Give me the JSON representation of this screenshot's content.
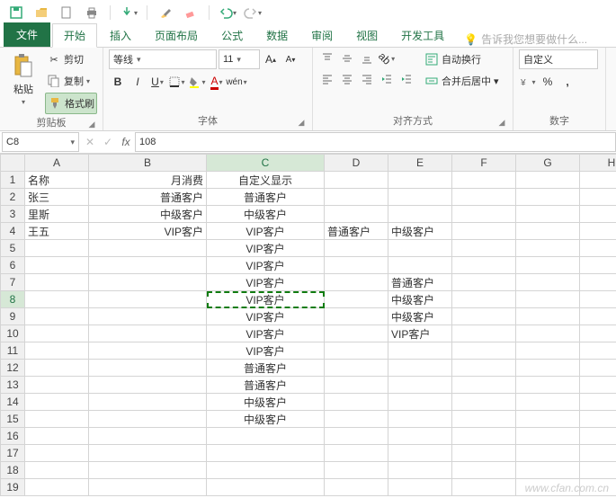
{
  "tabs": {
    "file": "文件",
    "items": [
      "开始",
      "插入",
      "页面布局",
      "公式",
      "数据",
      "审阅",
      "视图",
      "开发工具"
    ],
    "active_index": 0,
    "tell_me": "告诉我您想要做什么..."
  },
  "clipboard": {
    "paste": "粘贴",
    "cut": "剪切",
    "copy": "复制",
    "format_painter": "格式刷",
    "group_label": "剪贴板"
  },
  "font": {
    "name": "等线",
    "size": "11",
    "group_label": "字体"
  },
  "alignment": {
    "wrap": "自动换行",
    "merge": "合并后居中",
    "group_label": "对齐方式"
  },
  "number": {
    "format": "自定义",
    "group_label": "数字"
  },
  "formula_bar": {
    "cell_ref": "C8",
    "value": "108"
  },
  "columns": [
    "A",
    "B",
    "C",
    "D",
    "E",
    "F",
    "G",
    "H"
  ],
  "selected_col": "C",
  "selected_row": 8,
  "grid": [
    {
      "A": "名称",
      "B": "月消费",
      "C": "自定义显示",
      "D": "",
      "E": "",
      "F": ""
    },
    {
      "A": "张三",
      "B": "普通客户",
      "C": "普通客户",
      "D": "",
      "E": "",
      "F": ""
    },
    {
      "A": "里斯",
      "B": "中级客户",
      "C": "中级客户",
      "D": "",
      "E": "",
      "F": ""
    },
    {
      "A": "王五",
      "B": "VIP客户",
      "C": "VIP客户",
      "D": "普通客户",
      "E": "中级客户",
      "F": ""
    },
    {
      "A": "",
      "B": "",
      "C": "VIP客户",
      "D": "",
      "E": "",
      "F": ""
    },
    {
      "A": "",
      "B": "",
      "C": "VIP客户",
      "D": "",
      "E": "",
      "F": ""
    },
    {
      "A": "",
      "B": "",
      "C": "VIP客户",
      "D": "",
      "E": "普通客户",
      "F": ""
    },
    {
      "A": "",
      "B": "",
      "C": "VIP客户",
      "D": "",
      "E": "中级客户",
      "F": ""
    },
    {
      "A": "",
      "B": "",
      "C": "VIP客户",
      "D": "",
      "E": "中级客户",
      "F": ""
    },
    {
      "A": "",
      "B": "",
      "C": "VIP客户",
      "D": "",
      "E": "VIP客户",
      "F": ""
    },
    {
      "A": "",
      "B": "",
      "C": "VIP客户",
      "D": "",
      "E": "",
      "F": ""
    },
    {
      "A": "",
      "B": "",
      "C": "普通客户",
      "D": "",
      "E": "",
      "F": ""
    },
    {
      "A": "",
      "B": "",
      "C": "普通客户",
      "D": "",
      "E": "",
      "F": ""
    },
    {
      "A": "",
      "B": "",
      "C": "中级客户",
      "D": "",
      "E": "",
      "F": ""
    },
    {
      "A": "",
      "B": "",
      "C": "中级客户",
      "D": "",
      "E": "",
      "F": ""
    },
    {
      "A": "",
      "B": "",
      "C": "",
      "D": "",
      "E": "",
      "F": ""
    },
    {
      "A": "",
      "B": "",
      "C": "",
      "D": "",
      "E": "",
      "F": ""
    },
    {
      "A": "",
      "B": "",
      "C": "",
      "D": "",
      "E": "",
      "F": ""
    },
    {
      "A": "",
      "B": "",
      "C": "",
      "D": "",
      "E": "",
      "F": ""
    }
  ],
  "right_align_cols": [
    "B"
  ],
  "center_align_cols": [
    "C"
  ],
  "watermark": "www.cfan.com.cn"
}
